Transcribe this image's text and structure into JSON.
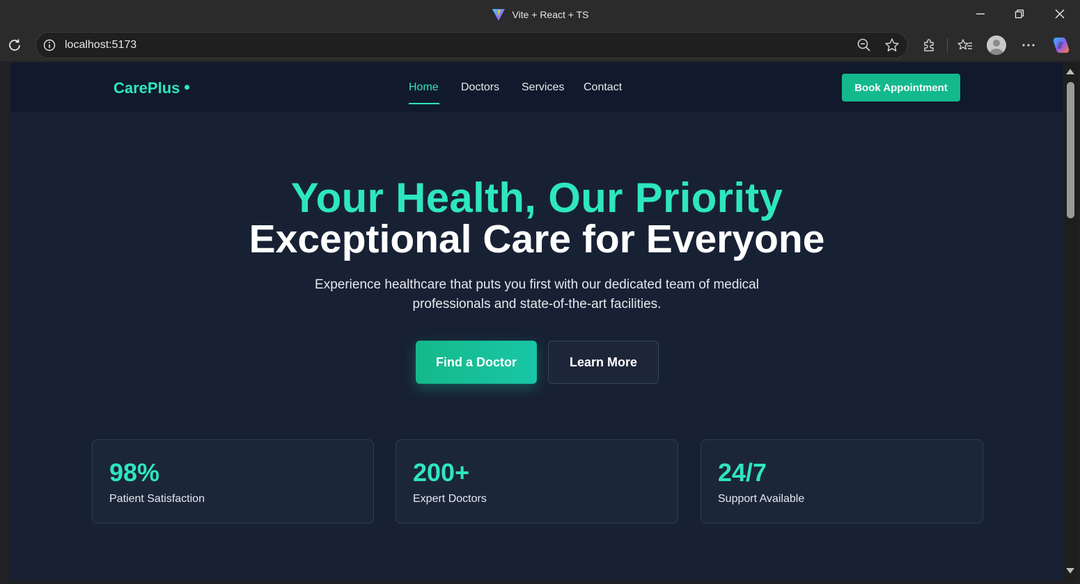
{
  "browser": {
    "tab_title": "Vite + React + TS",
    "url": "localhost:5173"
  },
  "site": {
    "logo": "CarePlus",
    "nav": [
      {
        "label": "Home",
        "active": true
      },
      {
        "label": "Doctors",
        "active": false
      },
      {
        "label": "Services",
        "active": false
      },
      {
        "label": "Contact",
        "active": false
      }
    ],
    "cta_label": "Book Appointment"
  },
  "hero": {
    "headline": "Your Health, Our Priority",
    "subheadline": "Exceptional Care for Everyone",
    "description": "Experience healthcare that puts you first with our dedicated team of medical professionals and state-of-the-art facilities.",
    "primary_button": "Find a Doctor",
    "secondary_button": "Learn More"
  },
  "stats": [
    {
      "value": "98%",
      "label": "Patient Satisfaction"
    },
    {
      "value": "200+",
      "label": "Expert Doctors"
    },
    {
      "value": "24/7",
      "label": "Support Available"
    }
  ],
  "colors": {
    "accent": "#2ee6bf",
    "button": "#13b98c",
    "background": "#182134",
    "nav_background": "#111a2c"
  },
  "icons": [
    "vite-logo-icon",
    "minimize-icon",
    "restore-icon",
    "close-icon",
    "reload-icon",
    "info-icon",
    "zoom-out-icon",
    "star-icon",
    "extensions-icon",
    "favorites-icon",
    "profile-icon",
    "more-icon",
    "copilot-icon"
  ]
}
